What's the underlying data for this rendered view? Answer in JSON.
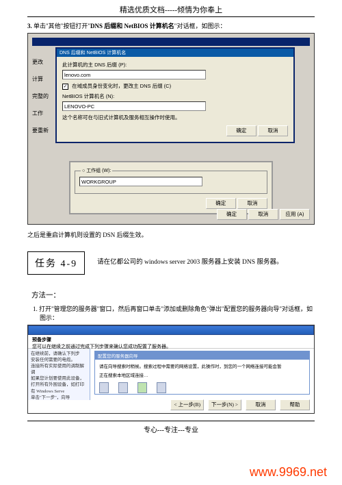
{
  "header": "精选优质文档-----倾情为你奉上",
  "step3": {
    "num": "3.",
    "before": "单击\"其他\"按钮打开\"",
    "bold": "DNS 后缀和 NetBIOS 计算机名",
    "after": "\"对话框，如图示："
  },
  "dlg1": {
    "outerLeft": {
      "a": "更改",
      "b": "计算",
      "c": "完整的",
      "d": "工作",
      "e": "要重新"
    },
    "title": "DNS 后缀和 NetBIOS 计算机名",
    "primaryLabel": "此计算机的主 DNS 后缀 (P):",
    "primary": "lenovo.com",
    "chk": "在域成员身份变化时，更改主 DNS 后缀 (C)",
    "nbLabel": "NetBIOS 计算机名 (N):",
    "nb": "LENOVO-PC",
    "note": "这个名称可在与旧式计算机及服务相互操作时使用。",
    "ok": "确定",
    "cancel": "取消"
  },
  "dlg2": {
    "grp": "工作组 (W):",
    "val": "WORKGROUP",
    "ok": "确定",
    "cancel": "取消"
  },
  "bottomBtns": {
    "ok": "确定",
    "cancel": "取消",
    "apply": "应用 (A)"
  },
  "afterShot1": "之后是重启计算机则设置的 DSN 后缀生效。",
  "task": {
    "label": "任务 4-9",
    "text": "请在亿都公司的 windows server 2003 服务器上安装 DNS 服务器。"
  },
  "method1": {
    "heading": "方法一：",
    "step": "1. 打开\"管理您的服务器\"窗口，然后再窗口单击\"添加或删除角色\"弹出\"配置您的服务器向导\"对话框，如图示："
  },
  "wiz": {
    "prepTitle": "预备步骤",
    "prepSub": "您可以在继续之前通过完成下列步骤来确认您成功配置了服务器。",
    "leftLines": [
      "在继续前，请确认下列步",
      "安装任何需要的电缆。",
      "连接所有实际使用的调制解调",
      "如果您计划要使用此设备，",
      "打开所有外围设备，如打印",
      "有 Windows Serve",
      "单击\"下一步\"，向导"
    ],
    "subTitle": "配置您的服务器向导",
    "subBody1": "请在向导搜索时稍候。搜索过程中需要的网络设置，此操作时，到您的一个网络连接可能会暂",
    "subBody2": "正在搜索本地区域连接…",
    "back": "< 上一步(B)",
    "next": "下一步(N) >",
    "cancel": "取消",
    "help": "帮助"
  },
  "footer": "专心---专注---专业",
  "watermark": "www.9969.net"
}
